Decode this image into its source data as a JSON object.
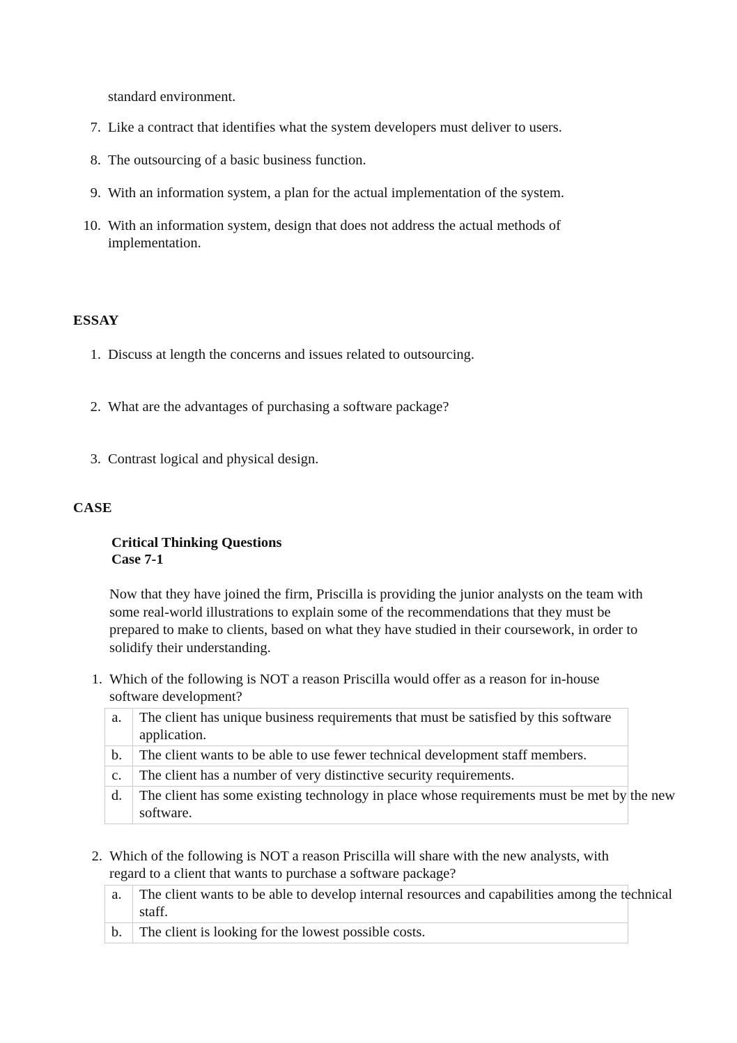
{
  "document": {
    "continued_fragment": "standard environment.",
    "matching_items": [
      {
        "number": "7.",
        "text": "Like a contract that identifies what the system developers must deliver to users."
      },
      {
        "number": "8.",
        "text": "The outsourcing of a basic business function."
      },
      {
        "number": "9.",
        "text": "With an information system, a plan for the actual implementation of the system."
      },
      {
        "number": "10.",
        "text": "With an information system, design that does not address the actual methods of implementation."
      }
    ],
    "essay": {
      "heading": "ESSAY",
      "items": [
        {
          "number": "1.",
          "text": "Discuss at length the concerns and issues related to outsourcing."
        },
        {
          "number": "2.",
          "text": "What are the advantages of purchasing a software package?"
        },
        {
          "number": "3.",
          "text": "Contrast logical and physical design."
        }
      ]
    },
    "case": {
      "heading": "CASE",
      "subheading": "Critical Thinking Questions",
      "case_label": "Case 7-1",
      "intro": "Now that they have joined the firm, Priscilla is providing the junior analysts on the team with some real-world illustrations to explain some of the recommendations that they must be prepared to make to clients, based on what they have studied in their coursework, in order to solidify their understanding.",
      "questions": [
        {
          "number": "1.",
          "text": "Which of the following is NOT a reason Priscilla would offer as a reason for in-house software development?",
          "options": [
            {
              "letter": "a.",
              "text": "The client has unique business requirements that must be satisfied by this software application."
            },
            {
              "letter": "b.",
              "text": "The client wants to be able to use fewer technical development staff members."
            },
            {
              "letter": "c.",
              "text": "The client has a number of very distinctive security requirements."
            },
            {
              "letter": "d.",
              "text": "The client has some existing technology in place whose requirements must be met by the new software."
            }
          ]
        },
        {
          "number": "2.",
          "text": "Which of the following is NOT a reason Priscilla will share with the new analysts, with regard to a client that wants to purchase a software package?",
          "options": [
            {
              "letter": "a.",
              "text": "The client wants to be able to develop internal resources and capabilities among the technical staff."
            },
            {
              "letter": "b.",
              "text": "The client is looking for the lowest possible costs."
            }
          ]
        }
      ]
    }
  }
}
